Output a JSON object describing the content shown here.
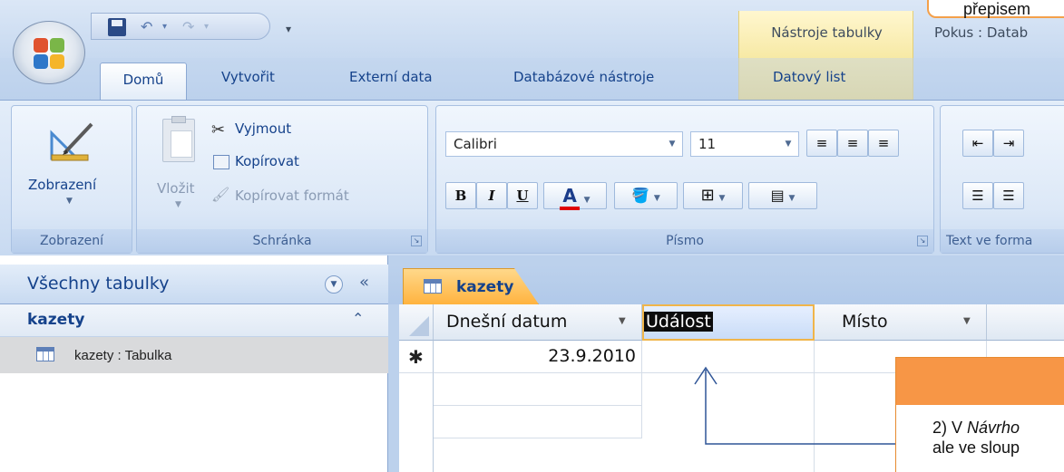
{
  "title_bar": {
    "contextual_tab_title": "Nástroje tabulky",
    "window_title": "Pokus : Datab"
  },
  "tabs": [
    "Domů",
    "Vytvořit",
    "Externí data",
    "Databázové nástroje",
    "Datový list"
  ],
  "ribbon": {
    "view_group": {
      "button_label": "Zobrazení",
      "label": "Zobrazení"
    },
    "clipboard_group": {
      "paste_label": "Vložit",
      "cut_label": "Vyjmout",
      "copy_label": "Kopírovat",
      "format_painter_label": "Kopírovat formát",
      "label": "Schránka"
    },
    "font_group": {
      "font_name": "Calibri",
      "font_size": "11",
      "bold": "B",
      "italic": "I",
      "underline": "U",
      "font_color": "A",
      "label": "Písmo"
    },
    "text_format_group": {
      "label": "Text ve forma"
    }
  },
  "nav_pane": {
    "title": "Všechny tabulky",
    "group": "kazety",
    "item": "kazety : Tabulka"
  },
  "document": {
    "tab_label": "kazety",
    "columns": [
      "Dnešní datum",
      "Událost",
      "Místo"
    ],
    "new_row_marker": "✱",
    "new_row_date": "23.9.2010"
  },
  "annotations": {
    "top_text": "přepisem",
    "bottom_text_prefix": "2) V ",
    "bottom_text_italic": "Návrho",
    "bottom_text_line2": "ale ve sloup"
  },
  "colors": {
    "accent_orange": "#f79646",
    "ribbon_blue": "#c8daf1",
    "text_blue": "#15428b"
  }
}
